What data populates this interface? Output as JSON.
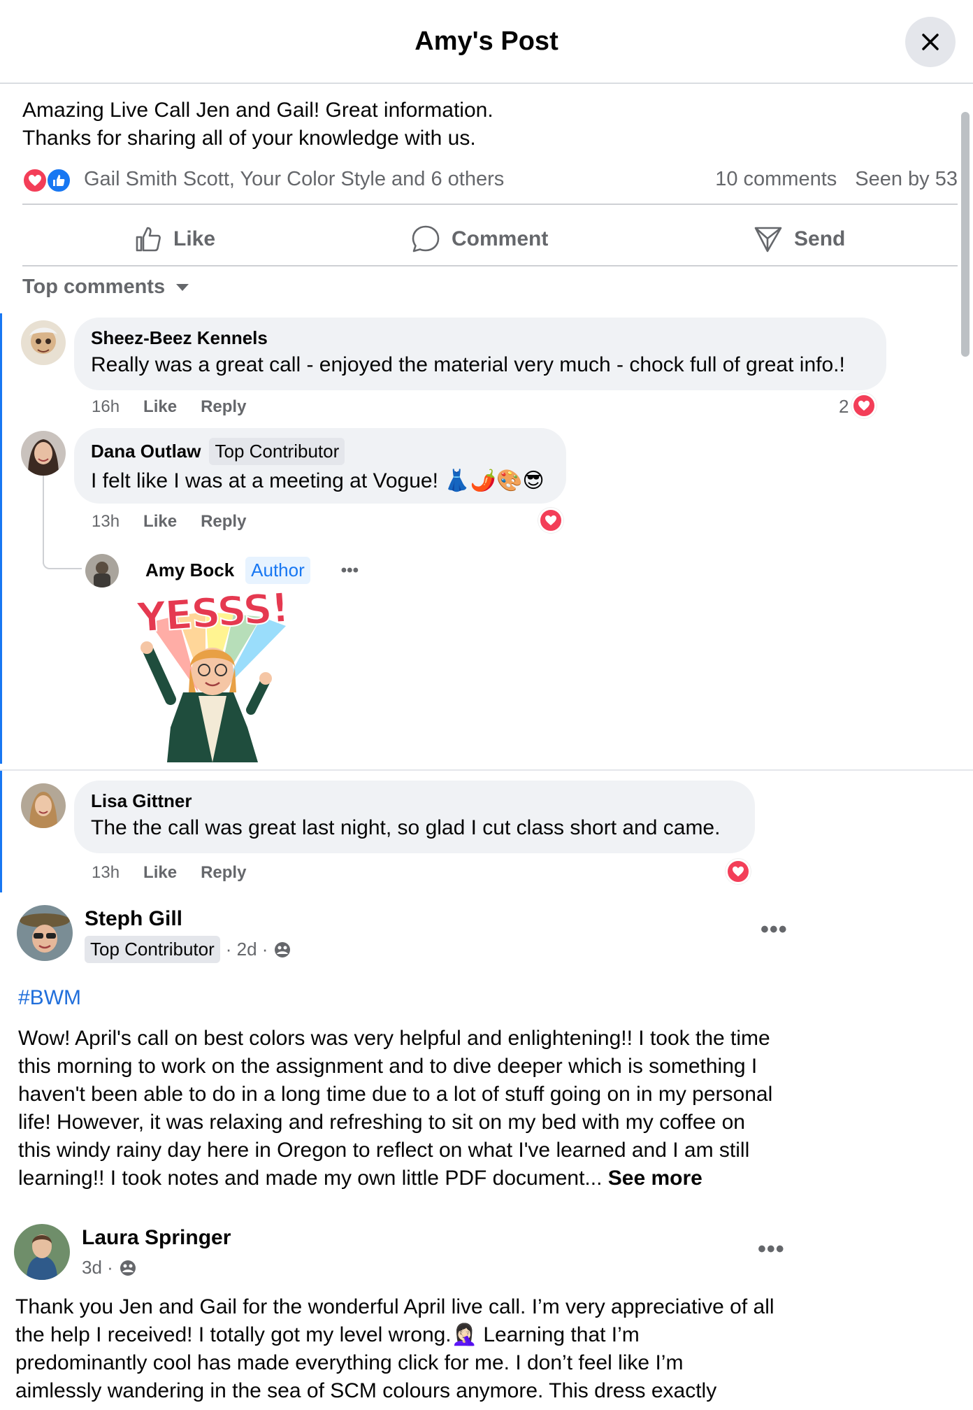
{
  "header": {
    "title": "Amy's Post"
  },
  "post": {
    "lines": [
      "Amazing Live Call Jen and Gail! Great information.",
      "Thanks for sharing all of your knowledge with us."
    ],
    "reaction_names": "Gail Smith Scott, Your Color Style and 6 others",
    "comments_count": "10 comments",
    "seen_by": "Seen by 53",
    "actions": {
      "like": "Like",
      "comment": "Comment",
      "send": "Send"
    },
    "sort_label": "Top comments"
  },
  "comments": [
    {
      "name": "Sheez-Beez Kennels",
      "text": "Really was a great call - enjoyed the material very much - chock full of great info.!",
      "time": "16h",
      "like": "Like",
      "reply": "Reply",
      "reaction_count": "2"
    },
    {
      "name": "Dana Outlaw",
      "badge": "Top Contributor",
      "text": "I felt like I was at a meeting at Vogue! 👗🌶️🎨😎",
      "time": "13h",
      "like": "Like",
      "reply": "Reply"
    },
    {
      "name": "Lisa Gittner",
      "text": "The the call was great last night, so glad I cut class short and came.",
      "time": "13h",
      "like": "Like",
      "reply": "Reply"
    }
  ],
  "reply": {
    "name": "Amy Bock",
    "badge": "Author",
    "more": "•••",
    "sticker_text": "YESSS!"
  },
  "feed": [
    {
      "name": "Steph Gill",
      "badge": "Top Contributor",
      "time": "· 2d ·",
      "more": "•••",
      "hashtag": "#BWM",
      "lines": [
        "Wow! April's call on best colors was very helpful and enlightening!! I took the time",
        "this morning to work on the assignment and to dive deeper which is something I",
        "haven't been able to do in a long time due to a lot of stuff going on in my personal",
        "life! However, it was relaxing and refreshing to sit on my bed with my coffee on",
        "this windy rainy day here in Oregon to reflect on what I've learned and I am still",
        "learning!! I took notes and made my own little PDF document..."
      ],
      "see_more": "See more"
    },
    {
      "name": "Laura Springer",
      "time": "3d ·",
      "more": "•••",
      "lines": [
        "Thank you Jen and Gail for the wonderful April live call. I’m very appreciative of all",
        "the help I received! I totally got my level wrong.🤦🏻‍♀️ Learning that I’m",
        "predominantly cool has made everything click for me. I don’t feel like I’m",
        "aimlessly wandering in the sea of SCM colours anymore. This dress exactly"
      ]
    }
  ]
}
